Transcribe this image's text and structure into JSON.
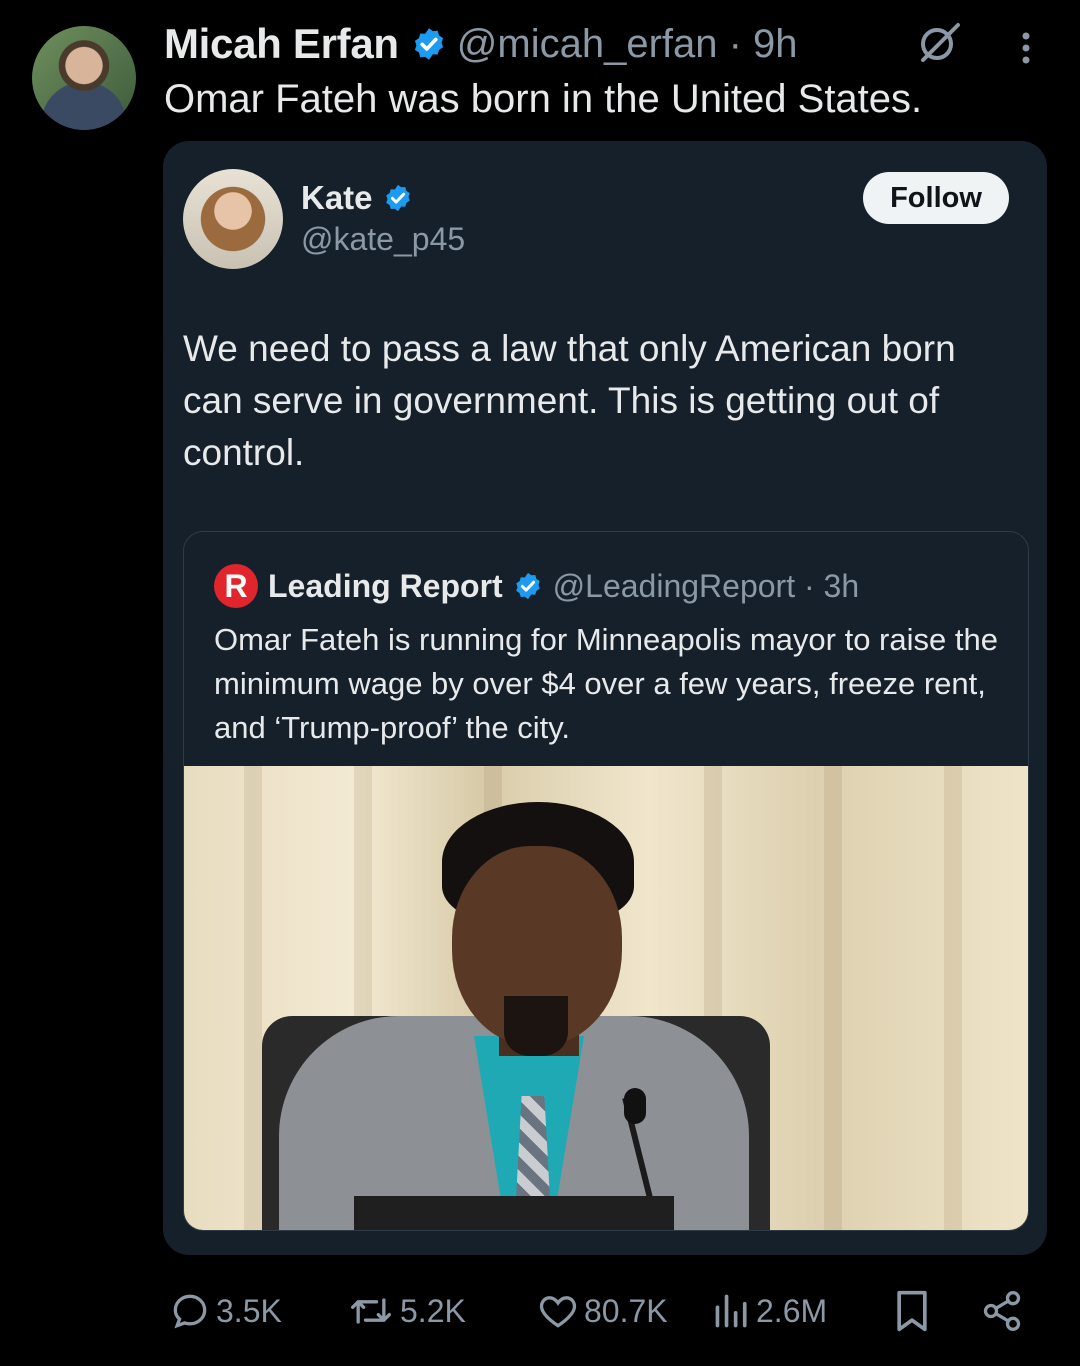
{
  "post": {
    "author_name": "Micah Erfan",
    "author_handle_time": "@micah_erfan · 9h",
    "text": "Omar Fateh was born in the United States."
  },
  "quoted": {
    "author_name": "Kate",
    "author_handle": "@kate_p45",
    "follow_label": "Follow",
    "text": "We need to pass a law that only American born can serve in government. This is getting out of control."
  },
  "nested_quote": {
    "logo_letter": "R",
    "author_name": "Leading Report",
    "author_handle_time": "@LeadingReport · 3h",
    "text": "Omar Fateh is running for Minneapolis mayor to raise the minimum wage by over $4 over a few years, freeze rent, and ‘Trump-proof’ the city."
  },
  "actions": {
    "replies": "3.5K",
    "reposts": "5.2K",
    "likes": "80.7K",
    "views": "2.6M"
  },
  "colors": {
    "verified": "#1d9bf0",
    "muted_text": "#8b98a5",
    "card_bg": "#15202b",
    "brand_red": "#e0252c"
  }
}
